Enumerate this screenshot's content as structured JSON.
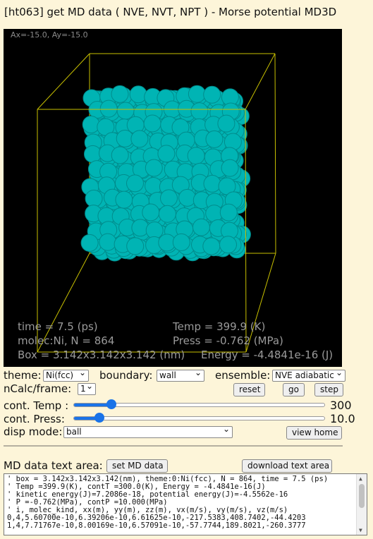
{
  "title": "[ht063] get MD data ( NVE, NVT, NPT ) - Morse potential MD3D",
  "viewer": {
    "angles": "Ax=-15.0, Ay=-15.0",
    "time": "time = 7.5 (ps)",
    "temp": "Temp = 399.9 (K)",
    "molec": "molec:Ni, N = 864",
    "press": "Press = -0.762 (MPa)",
    "box": "Box = 3.142x3.142x3.142 (nm)",
    "energy": "Energy = -4.4841e-16 (J)",
    "colors": {
      "atom": "#00b4b4",
      "frame": "#c8c000",
      "text": "#9a9a9a",
      "background": "#000000"
    }
  },
  "controls": {
    "theme_label": "theme:",
    "theme_value": "Ni(fcc)",
    "boundary_label": "boundary:",
    "boundary_value": "wall",
    "ensemble_label": "ensemble:",
    "ensemble_value": "NVE adiabatic",
    "ncalc_label": "nCalc/frame:",
    "ncalc_value": "1",
    "reset_label": "reset",
    "go_label": "go",
    "step_label": "step",
    "temp_label": "cont. Temp :",
    "temp_value": "300",
    "temp_fraction": 0.15,
    "press_label": "cont. Press:",
    "press_value": "10.0",
    "press_fraction": 0.1,
    "disp_label": "disp mode:",
    "disp_value": "ball",
    "view_home_label": "view home"
  },
  "data_area": {
    "label": "MD data text area:",
    "set_label": "set MD data",
    "download_label": "download text area",
    "lines": [
      "' box = 3.142x3.142x3.142(nm), theme:0:Ni(fcc), N = 864, time = 7.5 (ps)",
      "' Temp =399.9(K), contT =300.0(K), Energy = -4.4841e-16(J)",
      "' kinetic energy(J)=7.2086e-18, potential energy(J)=-4.5562e-16",
      "' P =-0.762(MPa), contP =10.000(MPa)",
      "' i, molec_kind, xx(m), yy(m), zz(m), vx(m/s), vy(m/s), vz(m/s)",
      "0,4,5.60700e-10,6.39206e-10,6.61625e-10,-217.5383,408.7402,-44.4203",
      "1,4,7.71767e-10,8.00169e-10,6.57091e-10,-57.7744,189.8021,-260.3777"
    ]
  }
}
